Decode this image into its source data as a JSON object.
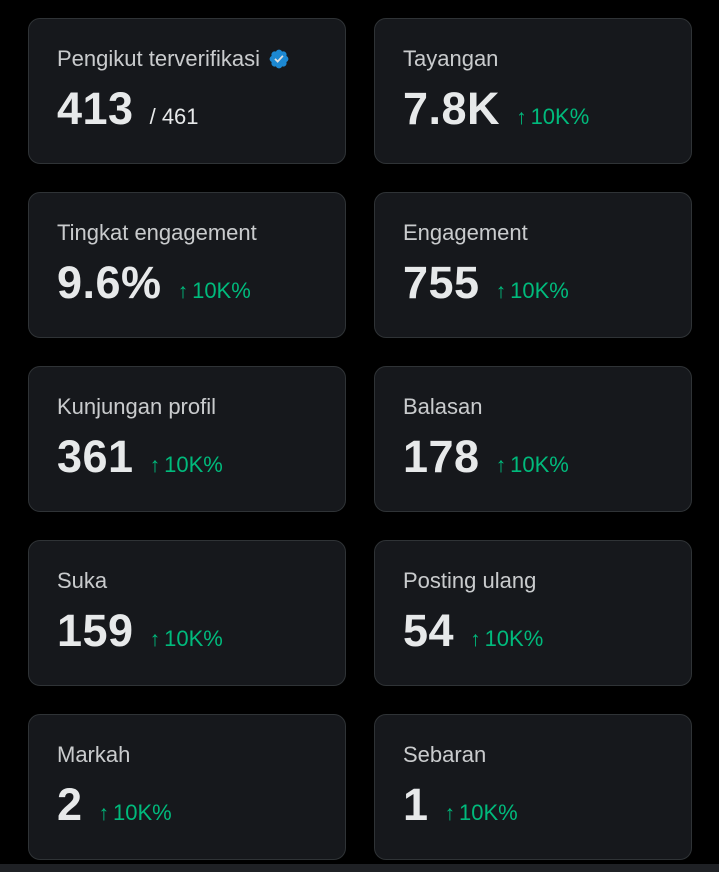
{
  "stats": [
    {
      "label": "Pengikut terverifikasi",
      "value": "413",
      "total": "/ 461",
      "delta": "",
      "verified": true
    },
    {
      "label": "Tayangan",
      "value": "7.8K",
      "total": "",
      "delta": "10K%"
    },
    {
      "label": "Tingkat engagement",
      "value": "9.6%",
      "total": "",
      "delta": "10K%"
    },
    {
      "label": "Engagement",
      "value": "755",
      "total": "",
      "delta": "10K%"
    },
    {
      "label": "Kunjungan profil",
      "value": "361",
      "total": "",
      "delta": "10K%"
    },
    {
      "label": "Balasan",
      "value": "178",
      "total": "",
      "delta": "10K%"
    },
    {
      "label": "Suka",
      "value": "159",
      "total": "",
      "delta": "10K%"
    },
    {
      "label": "Posting ulang",
      "value": "54",
      "total": "",
      "delta": "10K%"
    },
    {
      "label": "Markah",
      "value": "2",
      "total": "",
      "delta": "10K%"
    },
    {
      "label": "Sebaran",
      "value": "1",
      "total": "",
      "delta": "10K%"
    }
  ],
  "arrow_glyph": "↑",
  "colors": {
    "background": "#000000",
    "card": "#16181c",
    "border": "#2f3336",
    "text": "#e7e9ea",
    "positive": "#00ba7c",
    "verified": "#1d9bf0"
  }
}
